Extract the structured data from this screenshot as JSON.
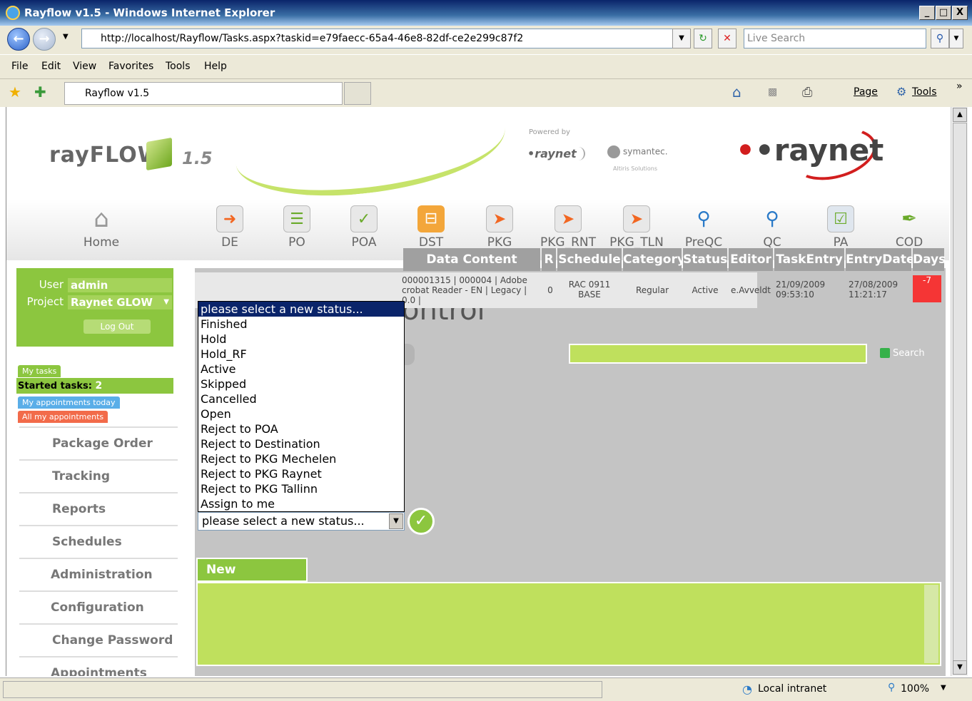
{
  "window": {
    "title": "Rayflow v1.5 - Windows Internet Explorer",
    "controls": [
      "_",
      "□",
      "X"
    ]
  },
  "address": {
    "url": "http://localhost/Rayflow/Tasks.aspx?taskid=e79faecc-65a4-46e8-82df-ce2e299c87f2",
    "search_placeholder": "Live Search"
  },
  "menu": [
    "File",
    "Edit",
    "View",
    "Favorites",
    "Tools",
    "Help"
  ],
  "tab": {
    "title": "Rayflow v1.5"
  },
  "command_bar": {
    "page": "Page",
    "tools": "Tools"
  },
  "header": {
    "logo": "rayFLOW",
    "version": "1.5",
    "powered_by": "Powered by",
    "raynet_small": "•raynet",
    "symantec": "symantec.",
    "altiris": "Altiris Solutions",
    "raynet_big": "•raynet"
  },
  "nav": [
    {
      "label": "Home",
      "icon": "home-icon"
    },
    {
      "label": "DE",
      "icon": "data-entry-icon"
    },
    {
      "label": "PO",
      "icon": "package-order-icon"
    },
    {
      "label": "POA",
      "icon": "package-order-approval-icon"
    },
    {
      "label": "DST",
      "icon": "distribution-icon"
    },
    {
      "label": "PKG",
      "icon": "package-icon"
    },
    {
      "label": "PKG_RNT",
      "icon": "package-rnt-icon"
    },
    {
      "label": "PKG_TLN",
      "icon": "package-tln-icon"
    },
    {
      "label": "PreQC",
      "icon": "pre-qc-icon"
    },
    {
      "label": "QC",
      "icon": "qc-icon"
    },
    {
      "label": "PA",
      "icon": "pa-icon"
    },
    {
      "label": "COD",
      "icon": "cod-icon"
    }
  ],
  "user": {
    "user_label": "User",
    "user_value": "admin",
    "project_label": "Project",
    "project_value": "Raynet GLOW",
    "logout": "Log Out"
  },
  "sidebar": {
    "my_tasks": "My tasks",
    "started_label": "Started tasks:",
    "started_count": "2",
    "appointments_today": "My appointments today",
    "all_appointments": "All my appointments",
    "items": [
      "Package Order",
      "Tracking",
      "Reports",
      "Schedules",
      "Administration",
      "Configuration",
      "Change Password",
      "Appointments"
    ]
  },
  "main": {
    "title_partial": "ontrol",
    "search_button": "Search",
    "table": {
      "headers": [
        "Data Content",
        "R",
        "Schedule",
        "Category",
        "Status",
        "Editor",
        "TaskEntry",
        "EntryDate",
        "Days"
      ],
      "row": {
        "data_content": [
          "000001315 | 000004 | Adobe",
          "crobat Reader - EN | Legacy |",
          "0.0 |"
        ],
        "r": "0",
        "schedule": [
          "RAC 0911",
          "BASE"
        ],
        "category": "Regular",
        "status": "Active",
        "editor": "e.Avveldt",
        "task_entry": [
          "21/09/2009",
          "09:53:10"
        ],
        "entry_date": [
          "27/08/2009",
          "11:21:17"
        ],
        "days": "-7"
      }
    },
    "status_dropdown": {
      "selected": "please select a new status...",
      "options": [
        "please select a new status...",
        "Finished",
        "Hold",
        "Hold_RF",
        "Active",
        "Skipped",
        "Cancelled",
        "Open",
        "Reject to POA",
        "Reject to Destination",
        "Reject to PKG Mechelen",
        "Reject to PKG Raynet",
        "Reject to PKG Tallinn",
        "Assign to me"
      ]
    },
    "new_comment": "New comment:"
  },
  "statusbar": {
    "zone": "Local intranet",
    "zoom": "100%"
  },
  "colors": {
    "accent_green": "#8cc63f",
    "panel_gray": "#c4c4c4",
    "overdue_red": "#f53535",
    "raynet_red": "#d21e1e"
  }
}
